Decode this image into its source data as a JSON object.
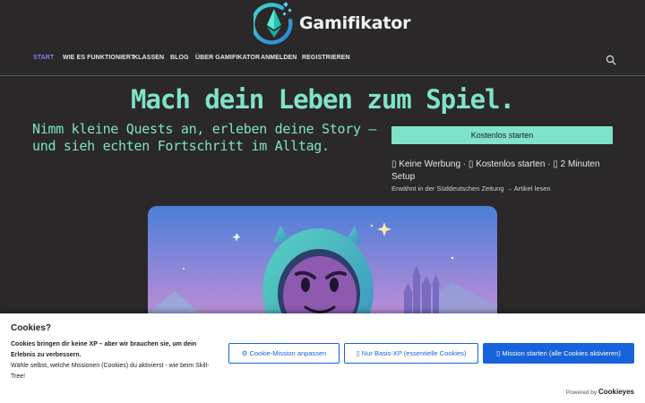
{
  "brand": {
    "name": "Gamifikator",
    "logo_icon": "ethereum-diamond-logo-icon"
  },
  "nav": {
    "items": [
      {
        "label": "START",
        "active": true
      },
      {
        "label": "WIE ES FUNKTIONIERT"
      },
      {
        "label": "KLASSEN"
      },
      {
        "label": "BLOG"
      },
      {
        "label": "ÜBER GAMIFIKATOR"
      },
      {
        "label": "ANMELDEN"
      },
      {
        "label": "REGISTRIEREN"
      }
    ],
    "search_icon": "search-icon"
  },
  "hero": {
    "title": "Mach dein Leben zum Spiel.",
    "subtitle": "Nimm kleine Quests an, erleben deine Story – und sieh echten Fortschritt im Alltag.",
    "cta_label": "Kostenlos starten",
    "benefits": "▯ Keine Werbung · ▯ Kostenlos starten · ▯ 2 Minuten Setup",
    "press_text": "Erwähnt in der Süddeutschen Zeitung → Artikel lesen"
  },
  "cookie": {
    "title": "Cookies?",
    "text_bold": "Cookies bringen dir keine XP – aber wir brauchen sie, um dein Erlebnis zu verbessern.",
    "text": "Wähle selbst, welche Missionen (Cookies) du aktivierst - wie beim Skill-Tree!",
    "btn_customize": "⚙ Cookie-Mission anpassen",
    "btn_reject": "▯ Nur Basis-XP (essentielle Cookies)",
    "btn_accept": "▯ Mission starten (alle Cookies aktivieren)",
    "powered_by": "Powered by",
    "powered_brand": "Cookieyes"
  },
  "colors": {
    "accent": "#7fe3c8",
    "active_nav": "#8b7cf6",
    "cookie_blue": "#1863dc",
    "background": "#2a2828"
  }
}
